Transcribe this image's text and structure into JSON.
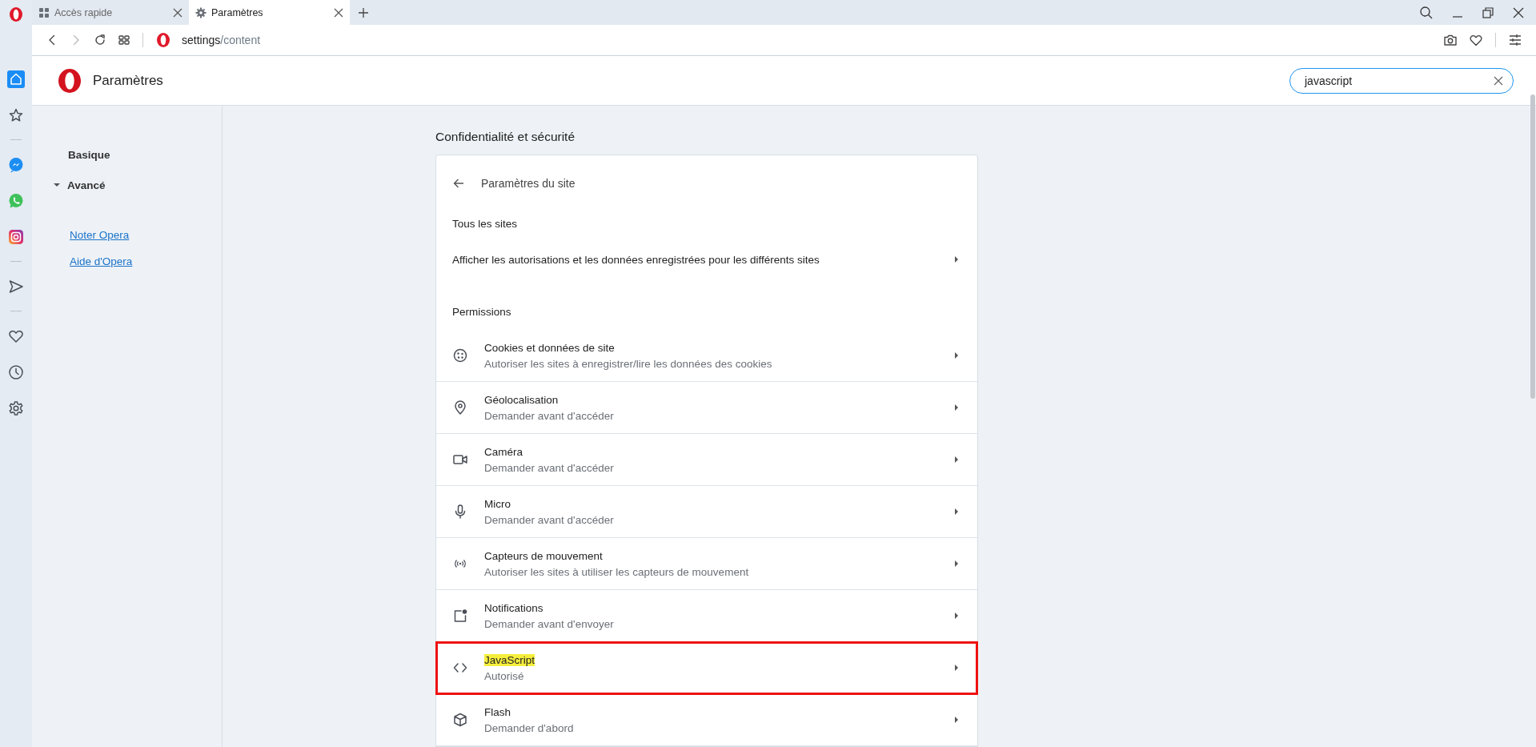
{
  "tabs": [
    {
      "label": "Accès rapide",
      "selected": false
    },
    {
      "label": "Paramètres",
      "selected": true
    }
  ],
  "address": {
    "host": "settings",
    "path": "/content"
  },
  "browser_sidebar": [
    {
      "selected": true
    },
    {
      "selected": false
    },
    {
      "selected": false
    },
    {
      "selected": false
    },
    {
      "selected": false
    },
    {
      "selected": false
    },
    {
      "selected": false
    },
    {
      "selected": false
    },
    {
      "selected": false
    }
  ],
  "header": {
    "title": "Paramètres",
    "search": {
      "value": "javascript"
    }
  },
  "nav": {
    "items": [
      {
        "label": "Basique",
        "kind": "plain"
      },
      {
        "label": "Avancé",
        "kind": "expandable",
        "expanded": true
      }
    ],
    "links": [
      "Noter Opera",
      "Aide d'Opera"
    ]
  },
  "section_title": "Confidentialité et sécurité",
  "card": {
    "title": "Paramètres du site",
    "all_sites_heading": "Tous les sites",
    "all_sites_row": "Afficher les autorisations et les données enregistrées pour les différents sites",
    "permissions_heading": "Permissions",
    "permissions": [
      {
        "title": "Cookies et données de site",
        "subtitle": "Autoriser les sites à enregistrer/lire les données des cookies",
        "outlined": false,
        "title_highlighted": false
      },
      {
        "title": "Géolocalisation",
        "subtitle": "Demander avant d'accéder",
        "outlined": false,
        "title_highlighted": false
      },
      {
        "title": "Caméra",
        "subtitle": "Demander avant d'accéder",
        "outlined": false,
        "title_highlighted": false
      },
      {
        "title": "Micro",
        "subtitle": "Demander avant d'accéder",
        "outlined": false,
        "title_highlighted": false
      },
      {
        "title": "Capteurs de mouvement",
        "subtitle": "Autoriser les sites à utiliser les capteurs de mouvement",
        "outlined": false,
        "title_highlighted": false
      },
      {
        "title": "Notifications",
        "subtitle": "Demander avant d'envoyer",
        "outlined": false,
        "title_highlighted": false
      },
      {
        "title": "JavaScript",
        "subtitle": "Autorisé",
        "outlined": true,
        "title_highlighted": true
      },
      {
        "title": "Flash",
        "subtitle": "Demander d'abord",
        "outlined": false,
        "title_highlighted": false
      }
    ]
  }
}
